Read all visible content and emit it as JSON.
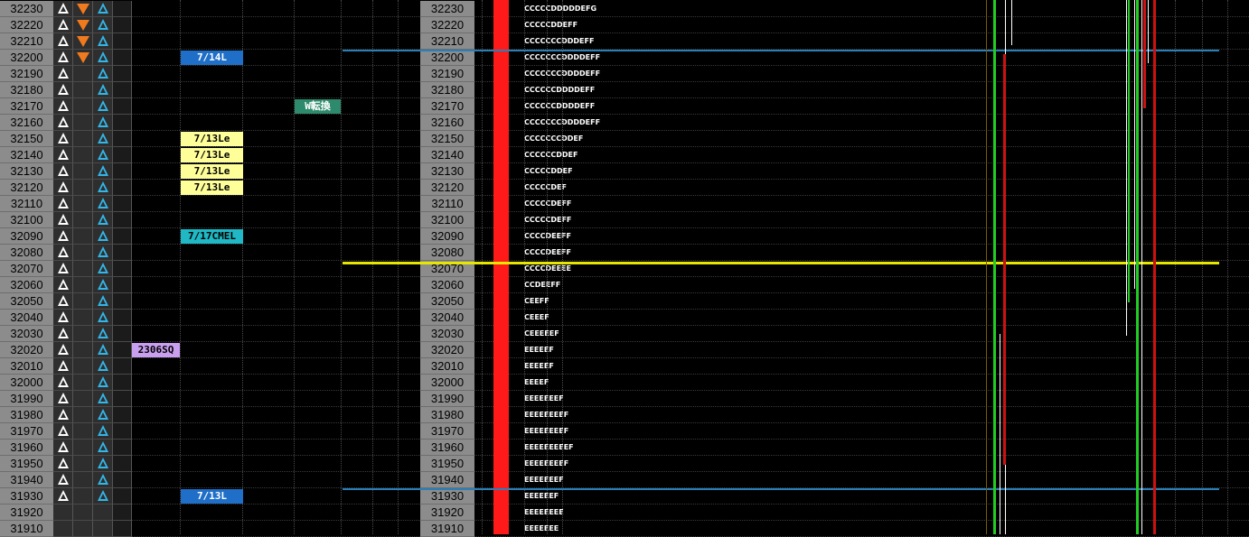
{
  "prices": [
    "32230",
    "32220",
    "32210",
    "32200",
    "32190",
    "32180",
    "32170",
    "32160",
    "32150",
    "32140",
    "32130",
    "32120",
    "32110",
    "32100",
    "32090",
    "32080",
    "32070",
    "32060",
    "32050",
    "32040",
    "32030",
    "32020",
    "32010",
    "32000",
    "31990",
    "31980",
    "31970",
    "31960",
    "31950",
    "31940",
    "31930",
    "31920",
    "31910"
  ],
  "marker_rows": {
    "white_triangle_up": [
      0,
      1,
      2,
      3,
      4,
      5,
      6,
      7,
      8,
      9,
      10,
      11,
      12,
      13,
      14,
      15,
      16,
      17,
      18,
      19,
      20,
      21,
      22,
      23,
      24,
      25,
      26,
      27,
      28,
      29,
      30
    ],
    "orange_triangle_down": [
      0,
      1,
      2,
      3
    ],
    "blue_triangle_up": [
      0,
      1,
      2,
      3,
      4,
      5,
      6,
      7,
      8,
      9,
      10,
      11,
      12,
      13,
      14,
      15,
      16,
      17,
      18,
      19,
      20,
      21,
      22,
      23,
      24,
      25,
      26,
      27,
      28,
      29,
      30
    ]
  },
  "tags": [
    {
      "row": 3,
      "text": "7/14L",
      "style": "blue"
    },
    {
      "row": 6,
      "text": "W転換",
      "style": "green"
    },
    {
      "row": 8,
      "text": "7/13Le",
      "style": "yellow"
    },
    {
      "row": 9,
      "text": "7/13Le",
      "style": "yellow"
    },
    {
      "row": 10,
      "text": "7/13Le",
      "style": "yellow"
    },
    {
      "row": 11,
      "text": "7/13Le",
      "style": "yellow"
    },
    {
      "row": 14,
      "text": "7/17CMEL",
      "style": "teal"
    },
    {
      "row": 21,
      "text": "2306SQ",
      "style": "lavender"
    },
    {
      "row": 30,
      "text": "7/13L",
      "style": "blue"
    }
  ],
  "tpo_profile": [
    "CCCCCDDDDDEFG",
    "CCCCCDDEFF",
    "CCCCCCCDDDEFF",
    "CCCCCCCDDDDEFF",
    "CCCCCCCDDDDEFF",
    "CCCCCCDDDDEFF",
    "CCCCCCDDDDEFF",
    "CCCCCCCDDDDEFF",
    "CCCCCCCDDEF",
    "CCCCCCDDEF",
    "CCCCCDDEF",
    "CCCCCDEF",
    "CCCCCDEFF",
    "CCCCCDEFF",
    "CCCCDEEFF",
    "CCCCDEEFF",
    "CCCCDEEEE",
    "CCDEEFF",
    "CEEFF",
    "CEEEF",
    "CEEEEEF",
    "EEEEEF",
    "EEEEEF",
    "EEEEF",
    "EEEEEEEF",
    "EEEEEEEEF",
    "EEEEEEEEF",
    "EEEEEEEEEF",
    "EEEEEEEEF",
    "EEEEEEEF",
    "EEEEEEF",
    "EEEEEEEE",
    "EEEEEEE"
  ],
  "colors": {
    "price_bg": "#8c8c8c",
    "volume_bar": "#ff1a1a",
    "yellow_line": "#e6e600",
    "blue_line": "#2a7fb8",
    "green": "#22cc22",
    "red": "#cc1111",
    "white": "#ffffff"
  },
  "levels": {
    "yellow_row": 16,
    "blue_rows": [
      3,
      30
    ]
  }
}
